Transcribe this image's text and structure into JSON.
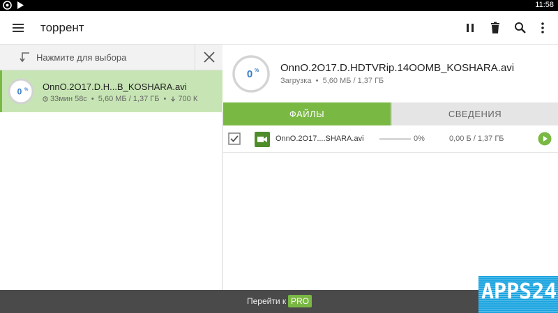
{
  "statusbar": {
    "time": "11:58"
  },
  "appbar": {
    "title": "торрент",
    "icons": [
      "menu-icon",
      "pause-icon",
      "delete-icon",
      "search-icon",
      "more-icon"
    ]
  },
  "selection": {
    "hint": "Нажмите для выбора"
  },
  "torrent_item": {
    "percent": "0",
    "percent_sign": "%",
    "name": "OnnO.2O17.D.H...B_KOSHARA.avi",
    "eta": "33мин 58с",
    "sizes": "5,60 МБ / 1,37 ГБ",
    "speed": "700 К",
    "progress": 0.0
  },
  "details": {
    "percent": "0",
    "percent_sign": "%",
    "name": "OnnO.2O17.D.HDTVRip.14OOMB_KOSHARA.avi",
    "status": "Загрузка",
    "sizes": "5,60 МБ / 1,37 ГБ"
  },
  "tabs": {
    "files": "ФАЙЛЫ",
    "details": "СВЕДЕНИЯ"
  },
  "file": {
    "checked": true,
    "name": "OnnO.2O17....SHARA.avi",
    "percent": "0%",
    "progress": 0.0,
    "sizes": "0,00 Б / 1,37 ГБ"
  },
  "bottombar": {
    "go": "Перейти к",
    "pro": "PRO"
  },
  "watermark": {
    "text": "APPS24"
  },
  "colors": {
    "accent": "#7ab844",
    "selected_bg": "#c7e5b4",
    "ring_text": "#3a7ec5"
  }
}
